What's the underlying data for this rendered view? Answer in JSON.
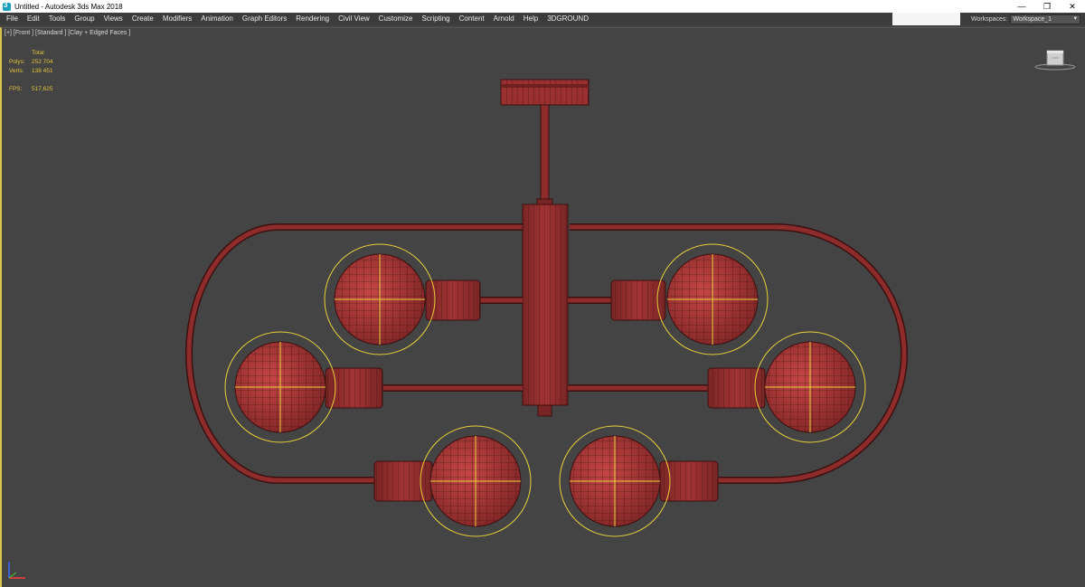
{
  "titlebar": {
    "title": "Untitled - Autodesk 3ds Max 2018",
    "app_icon": "3ds-max-icon",
    "minimize": "—",
    "restore": "❐",
    "close": "✕"
  },
  "menu": {
    "items": [
      "File",
      "Edit",
      "Tools",
      "Group",
      "Views",
      "Create",
      "Modifiers",
      "Animation",
      "Graph Editors",
      "Rendering",
      "Civil View",
      "Customize",
      "Scripting",
      "Content",
      "Arnold",
      "Help",
      "3DGROUND"
    ]
  },
  "workspaces": {
    "label": "Workspaces:",
    "value": "Workspace_1"
  },
  "viewport": {
    "label": "[+] [Front ] [Standard ] [Clay + Edged Faces ]",
    "stats": {
      "header": "Total",
      "polys_label": "Polys:",
      "polys_value": "252 704",
      "verts_label": "Verts:",
      "verts_value": "138 451",
      "fps_label": "FPS:",
      "fps_value": "517,625"
    },
    "viewcube_icon": "viewcube-icon",
    "axis_icon": "axis-tripod-icon"
  },
  "colors": {
    "viewport_bg": "#444444",
    "mesh": "#8a2a2a",
    "mesh_light": "#b33a3a",
    "wire": "#3b1010",
    "selection": "#e8d23a",
    "stats_text": "#e2c23a"
  }
}
